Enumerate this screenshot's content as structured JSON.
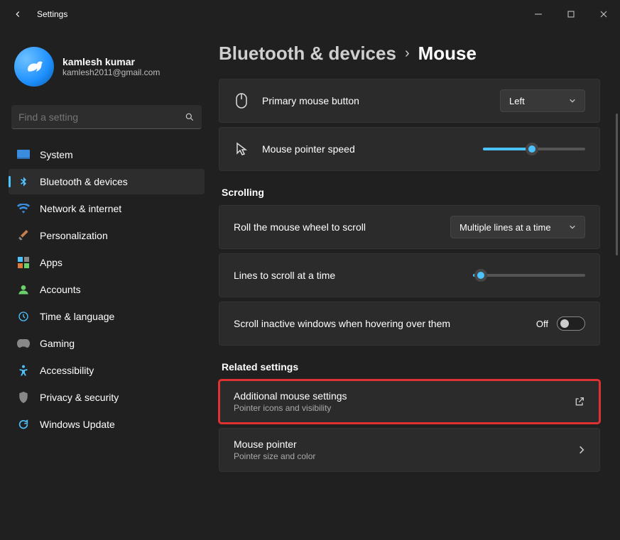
{
  "window_title": "Settings",
  "profile": {
    "name": "kamlesh kumar",
    "email": "kamlesh2011@gmail.com"
  },
  "search": {
    "placeholder": "Find a setting"
  },
  "nav": [
    {
      "id": "system",
      "label": "System"
    },
    {
      "id": "bluetooth",
      "label": "Bluetooth & devices"
    },
    {
      "id": "network",
      "label": "Network & internet"
    },
    {
      "id": "personalization",
      "label": "Personalization"
    },
    {
      "id": "apps",
      "label": "Apps"
    },
    {
      "id": "accounts",
      "label": "Accounts"
    },
    {
      "id": "time",
      "label": "Time & language"
    },
    {
      "id": "gaming",
      "label": "Gaming"
    },
    {
      "id": "accessibility",
      "label": "Accessibility"
    },
    {
      "id": "privacy",
      "label": "Privacy & security"
    },
    {
      "id": "update",
      "label": "Windows Update"
    }
  ],
  "breadcrumb": {
    "parent": "Bluetooth & devices",
    "current": "Mouse"
  },
  "settings": {
    "primary_button": {
      "label": "Primary mouse button",
      "value": "Left"
    },
    "pointer_speed": {
      "label": "Mouse pointer speed",
      "value": 48
    },
    "scrolling_header": "Scrolling",
    "wheel_scroll": {
      "label": "Roll the mouse wheel to scroll",
      "value": "Multiple lines at a time"
    },
    "lines_at_time": {
      "label": "Lines to scroll at a time",
      "value": 7
    },
    "inactive_windows": {
      "label": "Scroll inactive windows when hovering over them",
      "value": "Off"
    },
    "related_header": "Related settings",
    "additional": {
      "title": "Additional mouse settings",
      "sub": "Pointer icons and visibility"
    },
    "mouse_pointer": {
      "title": "Mouse pointer",
      "sub": "Pointer size and color"
    }
  }
}
